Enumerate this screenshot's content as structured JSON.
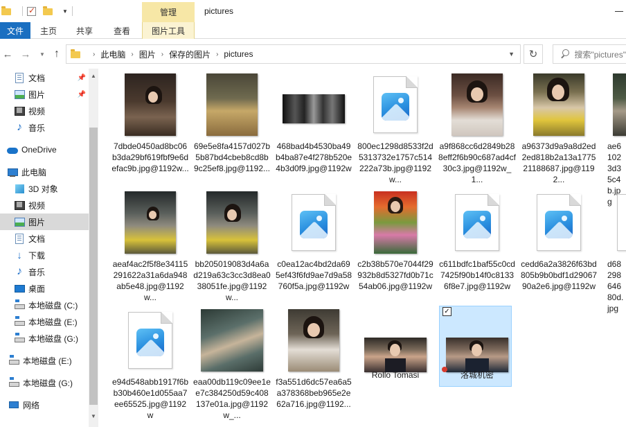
{
  "titlebar": {
    "title": "pictures",
    "manage_tab": "管理"
  },
  "ribbon": {
    "tabs": [
      {
        "label": "文件"
      },
      {
        "label": "主页"
      },
      {
        "label": "共享"
      },
      {
        "label": "查看"
      },
      {
        "label": "图片工具"
      }
    ]
  },
  "address": {
    "crumbs": [
      "此电脑",
      "图片",
      "保存的图片",
      "pictures"
    ],
    "search_placeholder": "搜索\"pictures\""
  },
  "sidebar": {
    "items": [
      {
        "label": "文档",
        "icon": "document-icon",
        "pinned": true
      },
      {
        "label": "图片",
        "icon": "pictures-icon",
        "pinned": true
      },
      {
        "label": "视频",
        "icon": "video-icon"
      },
      {
        "label": "音乐",
        "icon": "music-icon"
      },
      {
        "label": "OneDrive",
        "icon": "onedrive-icon"
      },
      {
        "label": "此电脑",
        "icon": "this-pc-icon"
      },
      {
        "label": "3D 对象",
        "icon": "3d-objects-icon"
      },
      {
        "label": "视频",
        "icon": "video-icon"
      },
      {
        "label": "图片",
        "icon": "pictures-icon",
        "selected": true
      },
      {
        "label": "文档",
        "icon": "document-icon"
      },
      {
        "label": "下载",
        "icon": "download-icon"
      },
      {
        "label": "音乐",
        "icon": "music-icon"
      },
      {
        "label": "桌面",
        "icon": "desktop-icon"
      },
      {
        "label": "本地磁盘 (C:)",
        "icon": "drive-icon"
      },
      {
        "label": "本地磁盘 (E:)",
        "icon": "drive-icon"
      },
      {
        "label": "本地磁盘 (G:)",
        "icon": "drive-icon"
      },
      {
        "label": "本地磁盘 (E:)",
        "icon": "drive-icon"
      },
      {
        "label": "本地磁盘 (G:)",
        "icon": "drive-icon"
      },
      {
        "label": "网络",
        "icon": "network-icon"
      }
    ]
  },
  "files": [
    {
      "name": "7dbde0450ad8bc06b3da29bf619fbf9e6defac9b.jpg@1192w...",
      "kind": "photo"
    },
    {
      "name": "69e5e8fa4157d027b5b87bd4cbeb8cd8b9c25ef8.jpg@1192...",
      "kind": "photo"
    },
    {
      "name": "468bad4b4530ba49b4ba87e4f278b520e4b3d0f9.jpg@1192w",
      "kind": "photo"
    },
    {
      "name": "800ec1298d8533f2d5313732e1757c514222a73b.jpg@1192w...",
      "kind": "file"
    },
    {
      "name": "a9f868cc6d2849b288eff2f6b90c687ad4cf30c3.jpg@1192w_1...",
      "kind": "photo"
    },
    {
      "name": "a96373d9a9a8d2ed2ed818b2a13a177521188687.jpg@1192...",
      "kind": "photo"
    },
    {
      "name": "ae61023d35c4b.jpg",
      "kind": "photo"
    },
    {
      "name": "aeaf4ac2f5f8e34115291622a31a6da948ab5e48.jpg@1192w...",
      "kind": "photo"
    },
    {
      "name": "bb205019083d4a6ad219a63c3cc3d8ea038051fe.jpg@1192w...",
      "kind": "photo"
    },
    {
      "name": "c0ea12ac4bd2da695ef43f6fd9ae7d9a58760f5a.jpg@1192w",
      "kind": "file"
    },
    {
      "name": "c2b38b570e7044f29932b8d5327fd0b71c54ab06.jpg@1192w",
      "kind": "photo"
    },
    {
      "name": "c611bdfc1baf55c0cd7425f90b14f0c81336f8e7.jpg@1192w",
      "kind": "file"
    },
    {
      "name": "cedd6a2a3826f63bd805b9b0bdf1d2906790a2e6.jpg@1192w",
      "kind": "file"
    },
    {
      "name": "d6829864680d.jpg",
      "kind": "file"
    },
    {
      "name": "e94d548abb1917f6bb30b460e1d055aa7ee65525.jpg@1192w",
      "kind": "file"
    },
    {
      "name": "eaa00db119c09ee1ee7c384250d59c408137e01a.jpg@1192w_...",
      "kind": "photo"
    },
    {
      "name": "f3a551d6dc57ea6a5a378368beb965e2e62a716.jpg@1192...",
      "kind": "photo"
    },
    {
      "name": "Rollo Tomasi",
      "kind": "video"
    },
    {
      "name": "洛城机密",
      "kind": "video",
      "selected": true
    }
  ],
  "colors": {
    "accent": "#1a6fc1",
    "selection": "#cce8ff",
    "selection_border": "#99d1ff",
    "manage_tab": "#f7e7a6"
  }
}
